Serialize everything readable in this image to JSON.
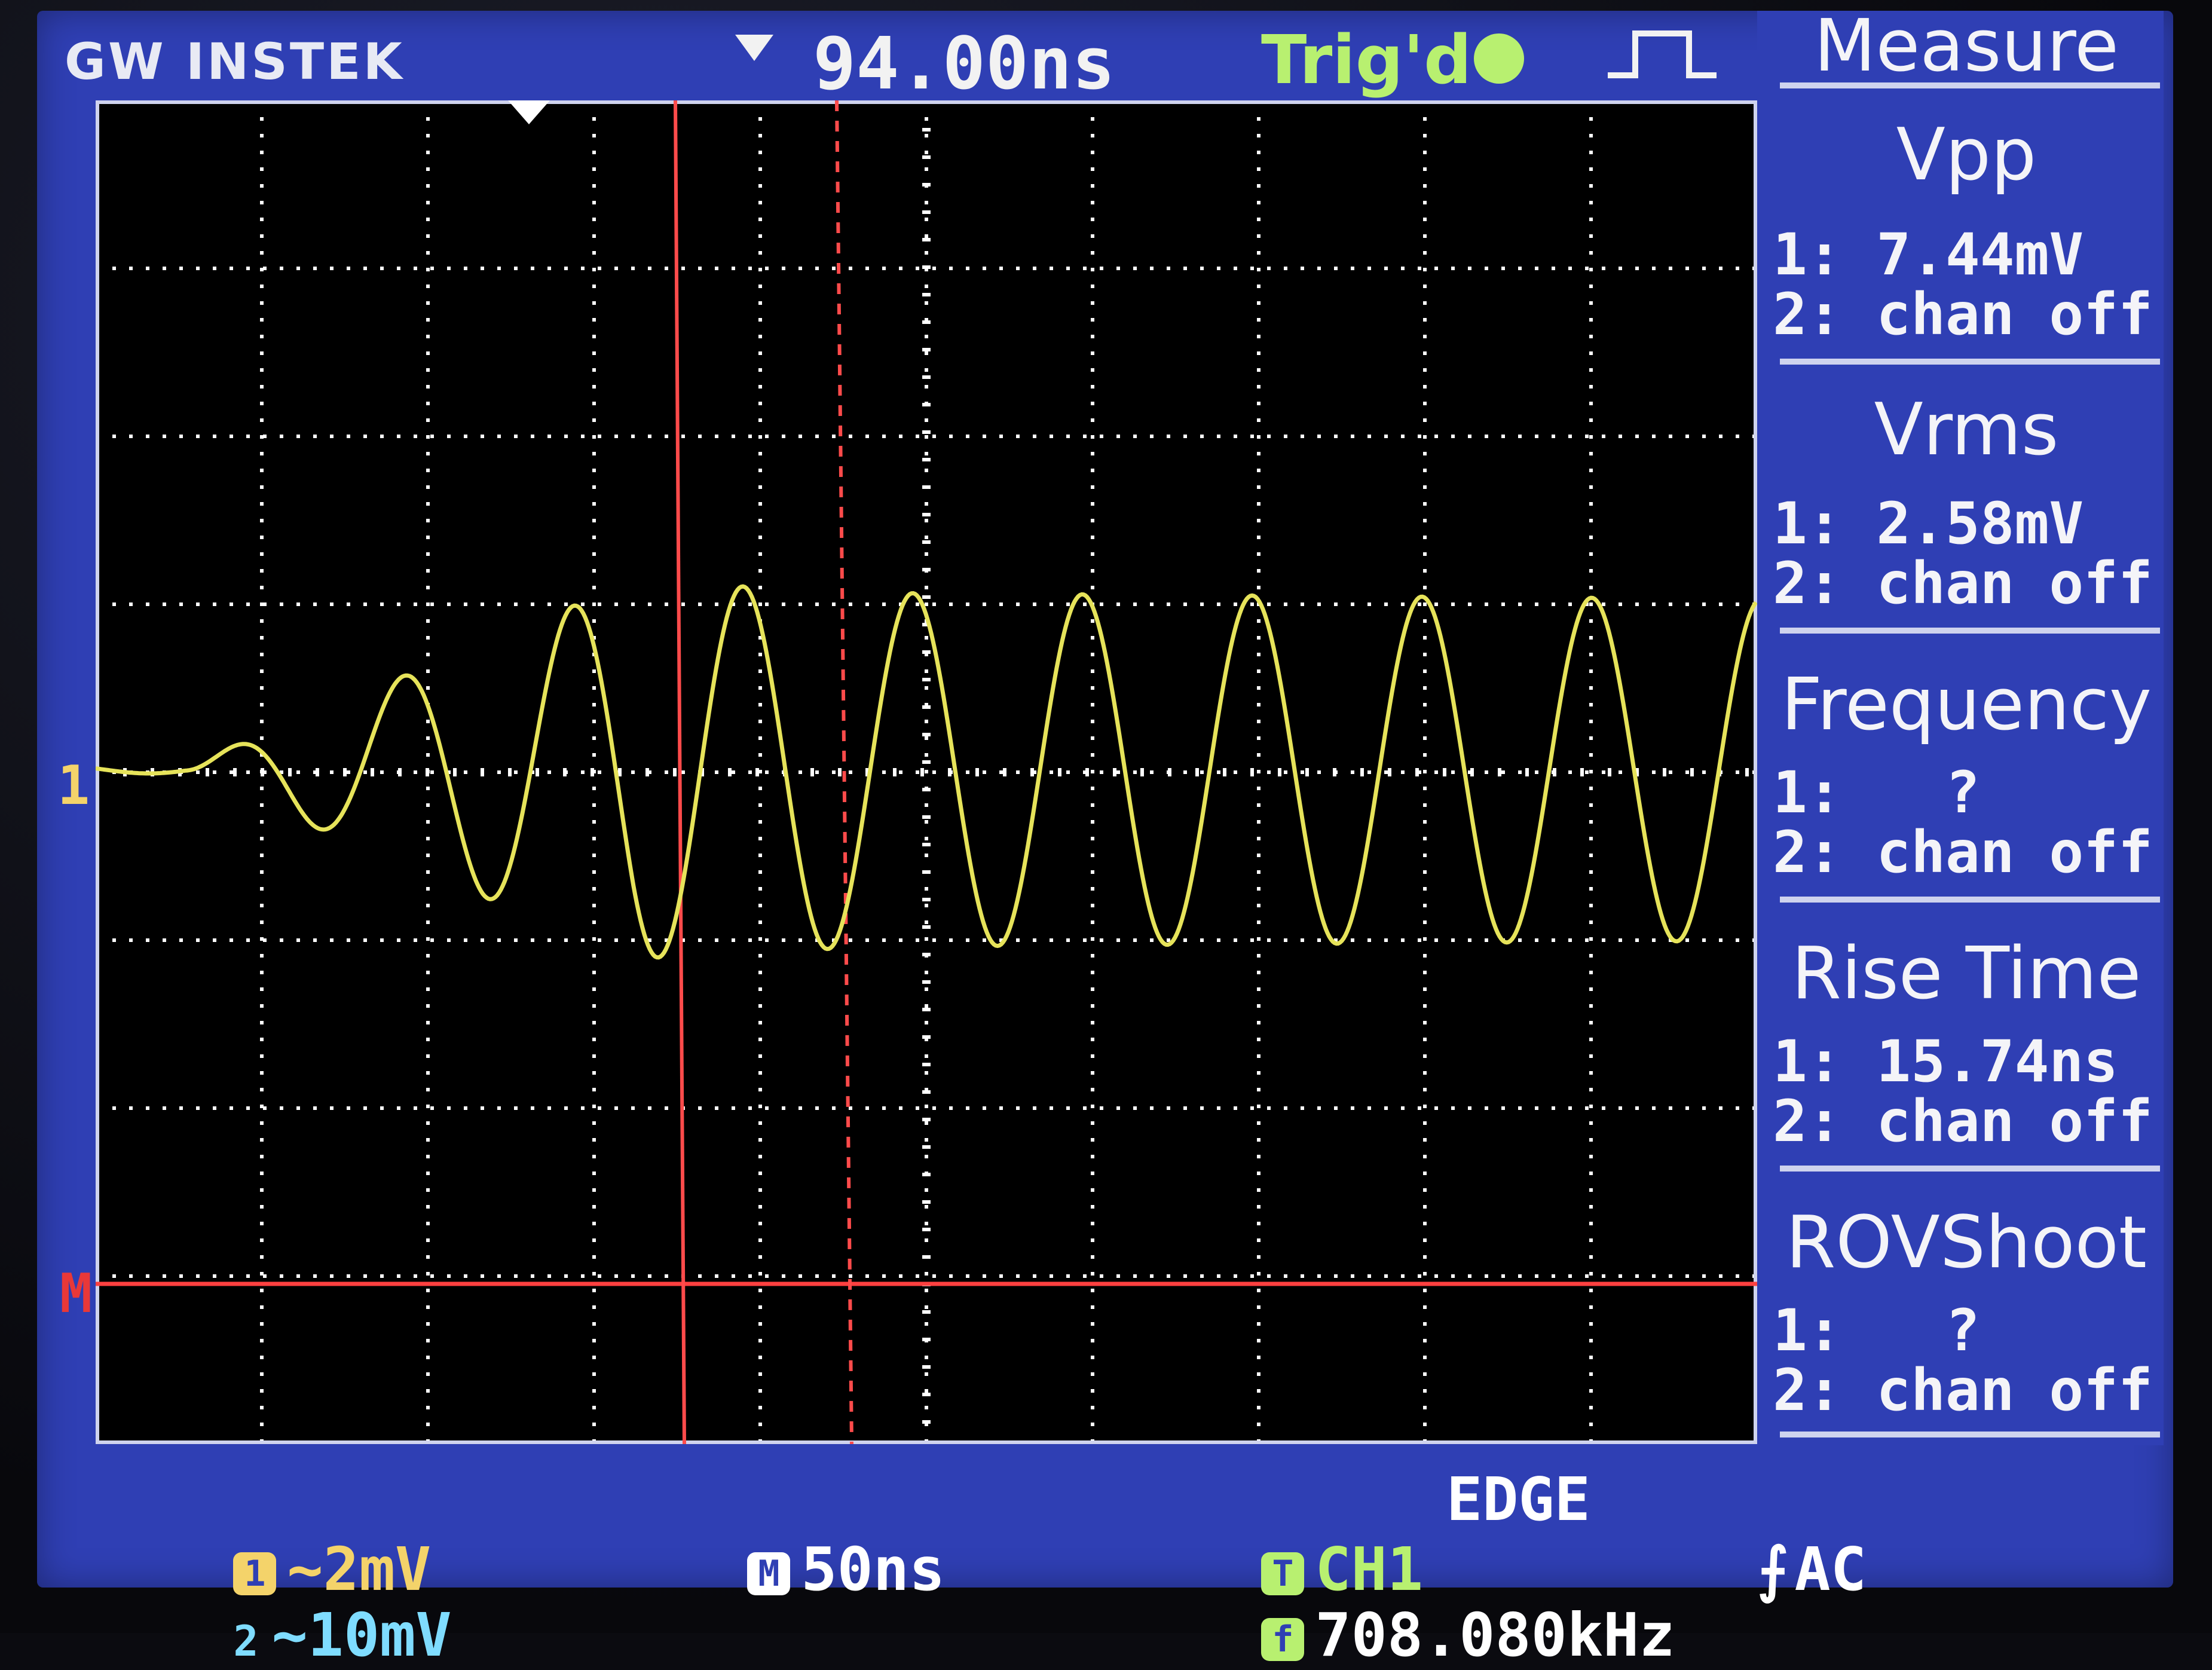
{
  "header": {
    "brand": "GW INSTEK",
    "delay": "94.00ns",
    "trigger_status": "Trig'd"
  },
  "measure": {
    "title": "Measure",
    "items": [
      {
        "name": "Vpp",
        "ch1": "1: 7.44mV",
        "ch2": "2: chan off"
      },
      {
        "name": "Vrms",
        "ch1": "1: 2.58mV",
        "ch2": "2: chan off"
      },
      {
        "name": "Frequency",
        "ch1": "1:   ?",
        "ch2": "2: chan off"
      },
      {
        "name": "Rise Time",
        "ch1": "1: 15.74ns",
        "ch2": "2: chan off"
      },
      {
        "name": "ROVShoot",
        "ch1": "1:   ?",
        "ch2": "2: chan off"
      }
    ]
  },
  "markers": {
    "ch1": "1",
    "math": "M"
  },
  "status": {
    "ch1_scale": "~2mV",
    "ch2_scale": "~10mV",
    "ch2_label": "2",
    "timebase": "50ns",
    "trigger_source": "CH1",
    "trigger_type": "EDGE",
    "trigger_coupling": "AC",
    "trigger_freq": "708.080kHz"
  },
  "colors": {
    "screen_bg": "#2f3fb4",
    "ch1": "#e6e35a",
    "cursor": "#ff4040",
    "grid": "#ffffff",
    "trig": "#b8f070"
  },
  "icons": [
    "trigger-edge-icon",
    "delay-arrow-icon",
    "trig-dot-icon",
    "rising-edge-icon"
  ]
}
